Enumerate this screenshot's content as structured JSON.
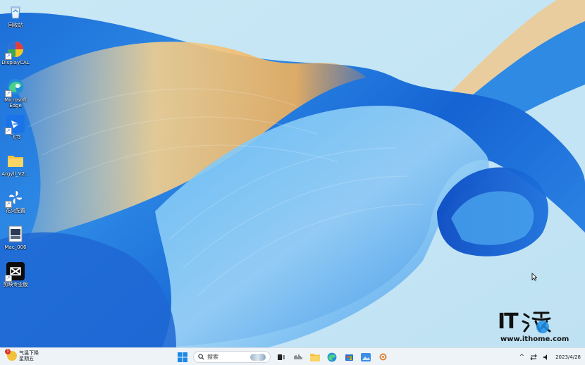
{
  "desktop": {
    "icons": [
      {
        "label": "回收站",
        "icon": "recycle-bin-icon",
        "shortcut": false
      },
      {
        "label": "DisplayCAL",
        "icon": "displaycal-icon",
        "shortcut": true
      },
      {
        "label": "Microsoft Edge",
        "icon": "edge-icon",
        "shortcut": true
      },
      {
        "label": "飞书",
        "icon": "feishu-icon",
        "shortcut": true
      },
      {
        "label": "Argyll_V2...",
        "icon": "folder-icon",
        "shortcut": false
      },
      {
        "label": "花火配置",
        "icon": "app-pinwheel-icon",
        "shortcut": true
      },
      {
        "label": "Mac_006",
        "icon": "image-file-icon",
        "shortcut": false
      },
      {
        "label": "剪映专业版",
        "icon": "capcut-icon",
        "shortcut": true
      }
    ]
  },
  "taskbar": {
    "weather": {
      "line1": "气温下降",
      "line2": "星期五",
      "badge": "1"
    },
    "search": {
      "placeholder": "搜索"
    },
    "pinned": [
      "start-button",
      "search",
      "task-view-icon",
      "widgets-icon",
      "file-explorer-icon",
      "edge-icon",
      "store-icon",
      "photos-icon",
      "settings-icon"
    ],
    "tray": {
      "chevron": "^",
      "date_text": "2023/4/28"
    }
  },
  "watermark": {
    "logo_text": "IT",
    "url": "www.ithome.com"
  }
}
